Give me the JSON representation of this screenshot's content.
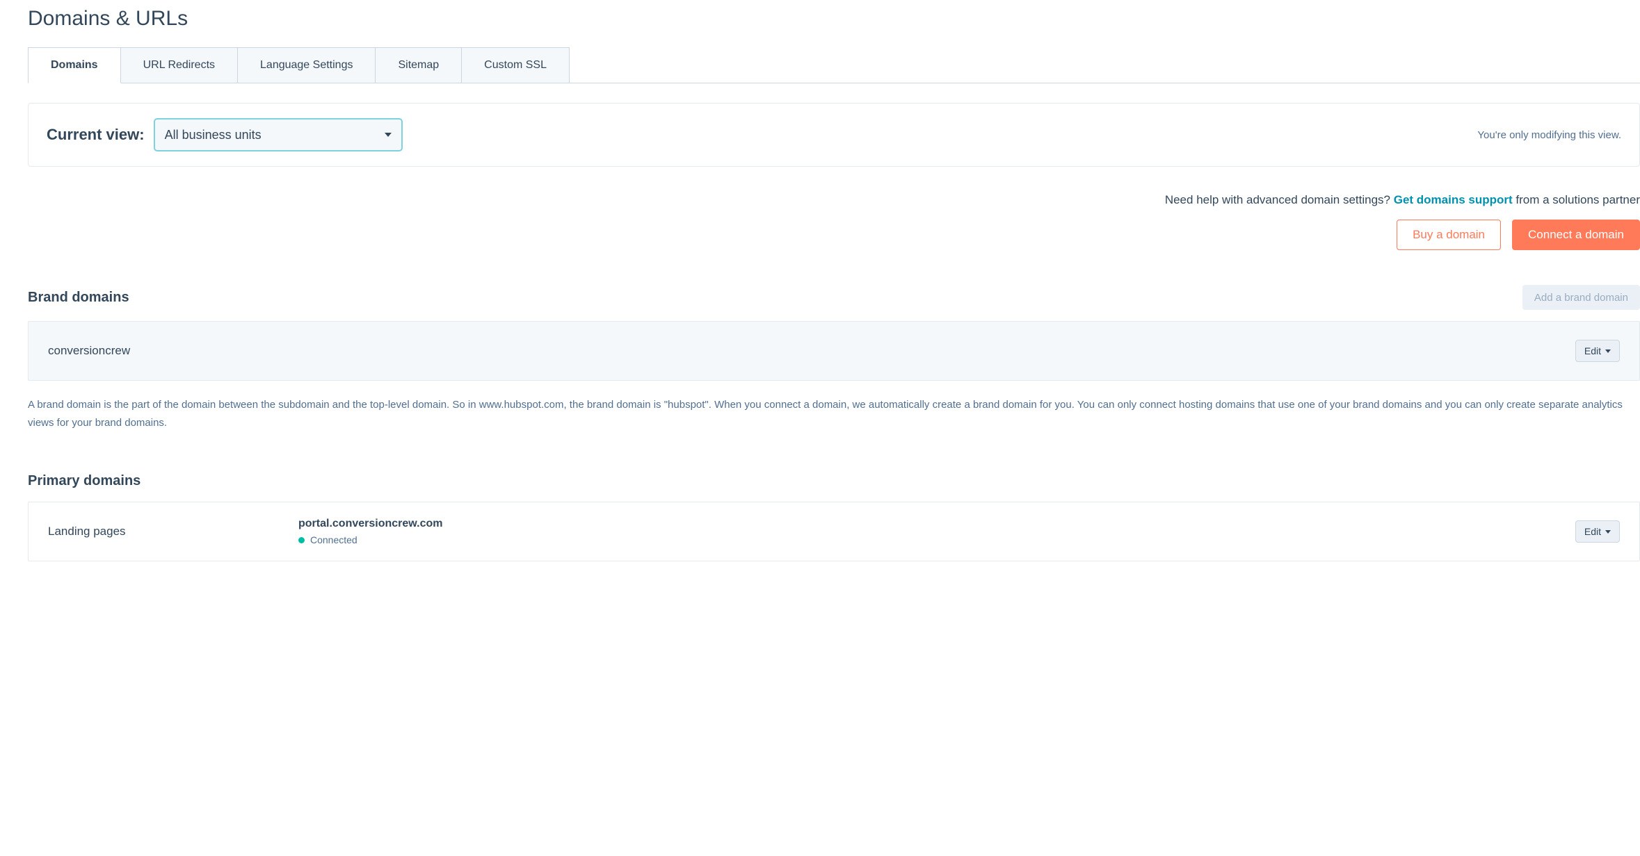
{
  "page_title": "Domains & URLs",
  "tabs": {
    "t0": "Domains",
    "t1": "URL Redirects",
    "t2": "Language Settings",
    "t3": "Sitemap",
    "t4": "Custom SSL"
  },
  "view": {
    "label": "Current view:",
    "selected": "All business units",
    "note": "You're only modifying this view."
  },
  "help": {
    "prefix": "Need help with advanced domain settings? ",
    "link": "Get domains support",
    "suffix": " from a solutions partner"
  },
  "actions": {
    "buy": "Buy a domain",
    "connect": "Connect a domain"
  },
  "brand": {
    "title": "Brand domains",
    "add_button": "Add a brand domain",
    "domain_name": "conversioncrew",
    "edit": "Edit",
    "description": "A brand domain is the part of the domain between the subdomain and the top-level domain. So in www.hubspot.com, the brand domain is \"hubspot\". When you connect a domain, we automatically create a brand domain for you. You can only connect hosting domains that use one of your brand domains and you can only create separate analytics views for your brand domains."
  },
  "primary": {
    "title": "Primary domains",
    "type": "Landing pages",
    "domain": "portal.conversioncrew.com",
    "status": "Connected",
    "edit": "Edit"
  }
}
